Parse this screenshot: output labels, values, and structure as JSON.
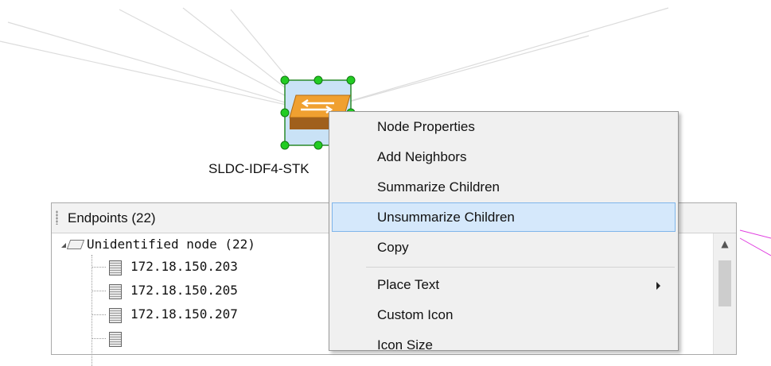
{
  "switch": {
    "label": "SLDC-IDF4-STK"
  },
  "endpoints": {
    "title": "Endpoints (22)",
    "tree": {
      "group_label": "Unidentified node (22)",
      "children": [
        "172.18.150.203",
        "172.18.150.205",
        "172.18.150.207"
      ]
    }
  },
  "context_menu": {
    "items": [
      {
        "label": "Node Properties"
      },
      {
        "label": "Add Neighbors"
      },
      {
        "label": "Summarize Children"
      },
      {
        "label": "Unsummarize Children",
        "highlighted": true
      },
      {
        "label": "Copy"
      },
      {
        "label": "Place Text",
        "has_submenu": true
      },
      {
        "label": "Custom Icon"
      },
      {
        "label": "Icon Size"
      }
    ]
  },
  "colors": {
    "selection_handle": "#22cc22",
    "menu_highlight": "#d5e8fb",
    "switch_orange": "#f0a030",
    "edge_magenta": "#e040e0"
  },
  "icons": {
    "switch": "network-switch-icon",
    "group": "node-group-icon",
    "leaf": "server-icon"
  }
}
